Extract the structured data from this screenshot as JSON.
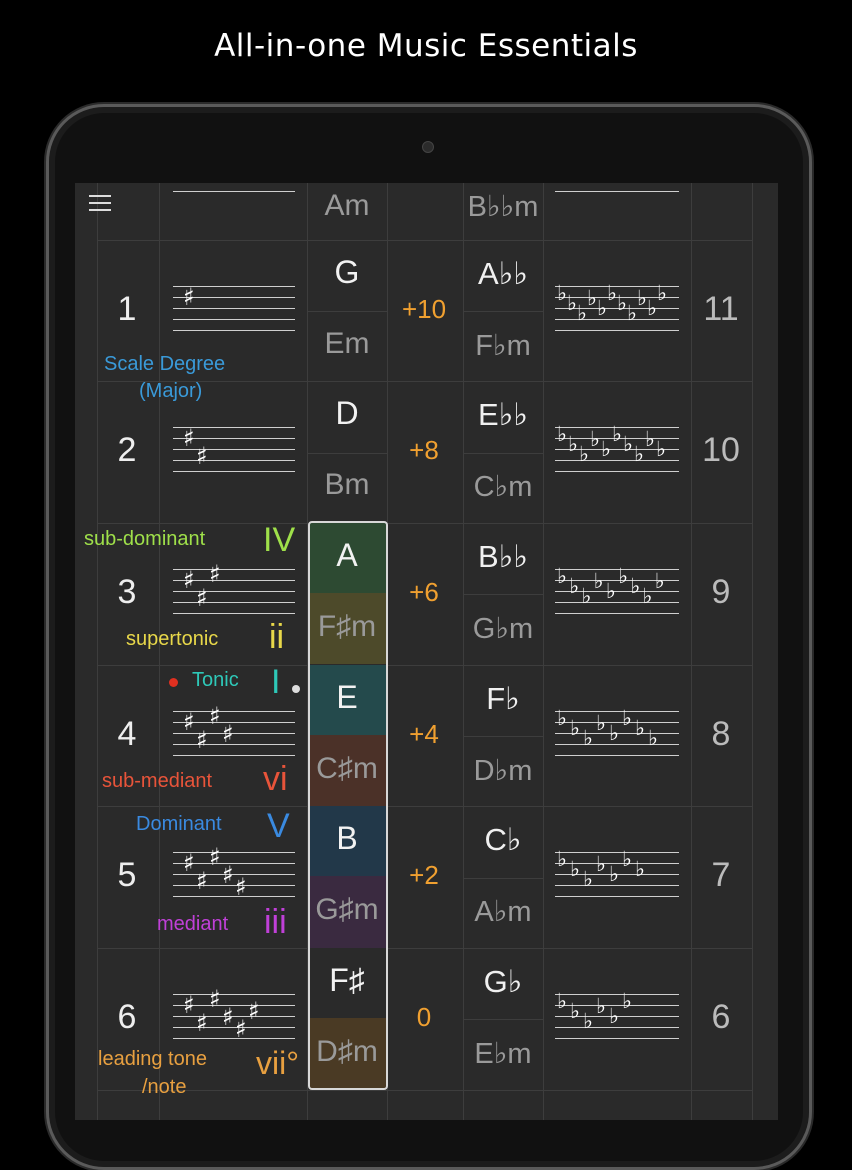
{
  "headline": "All-in-one Music Essentials",
  "top_row": {
    "minor": "Am",
    "rel_minor": "B♭♭m"
  },
  "rows": [
    {
      "num": "1",
      "major": "G",
      "minor": "Em",
      "offset": "+10",
      "rel_major": "A♭♭",
      "rel_minor": "F♭m",
      "count": "11",
      "sharps": 1,
      "flats": 11
    },
    {
      "num": "2",
      "major": "D",
      "minor": "Bm",
      "offset": "+8",
      "rel_major": "E♭♭",
      "rel_minor": "C♭m",
      "count": "10",
      "sharps": 2,
      "flats": 10
    },
    {
      "num": "3",
      "major": "A",
      "minor": "F♯m",
      "offset": "+6",
      "rel_major": "B♭♭",
      "rel_minor": "G♭m",
      "count": "9",
      "sharps": 3,
      "flats": 9
    },
    {
      "num": "4",
      "major": "E",
      "minor": "C♯m",
      "offset": "+4",
      "rel_major": "F♭",
      "rel_minor": "D♭m",
      "count": "8",
      "sharps": 4,
      "flats": 8
    },
    {
      "num": "5",
      "major": "B",
      "minor": "G♯m",
      "offset": "+2",
      "rel_major": "C♭",
      "rel_minor": "A♭m",
      "count": "7",
      "sharps": 5,
      "flats": 7
    },
    {
      "num": "6",
      "major": "F♯",
      "minor": "D♯m",
      "offset": "0",
      "rel_major": "G♭",
      "rel_minor": "E♭m",
      "count": "6",
      "sharps": 6,
      "flats": 6
    }
  ],
  "labels": {
    "scale_degree": "Scale Degree",
    "scale_degree_sub": "(Major)",
    "sub_dominant": "sub-dominant",
    "sub_dominant_numeral": "IV",
    "supertonic": "supertonic",
    "supertonic_numeral": "ii",
    "tonic": "Tonic",
    "tonic_numeral": "I",
    "sub_mediant": "sub-mediant",
    "sub_mediant_numeral": "vi",
    "dominant": "Dominant",
    "dominant_numeral": "V",
    "mediant": "mediant",
    "mediant_numeral": "iii",
    "leading_tone": "leading tone",
    "leading_tone_sub": "/note",
    "leading_tone_numeral": "vii°"
  },
  "colors": {
    "scale_degree": "#3a9ad9",
    "sub_dominant": "#9fe04a",
    "supertonic": "#e8d84a",
    "tonic": "#2ec8b8",
    "sub_mediant": "#e8543a",
    "dominant": "#3a8ae0",
    "mediant": "#c040d8",
    "leading_tone": "#e8a040",
    "offset": "#f0a030"
  },
  "icons": {
    "menu": "hamburger-menu-icon",
    "sharp": "sharp-accidental-icon",
    "flat": "flat-accidental-icon"
  }
}
